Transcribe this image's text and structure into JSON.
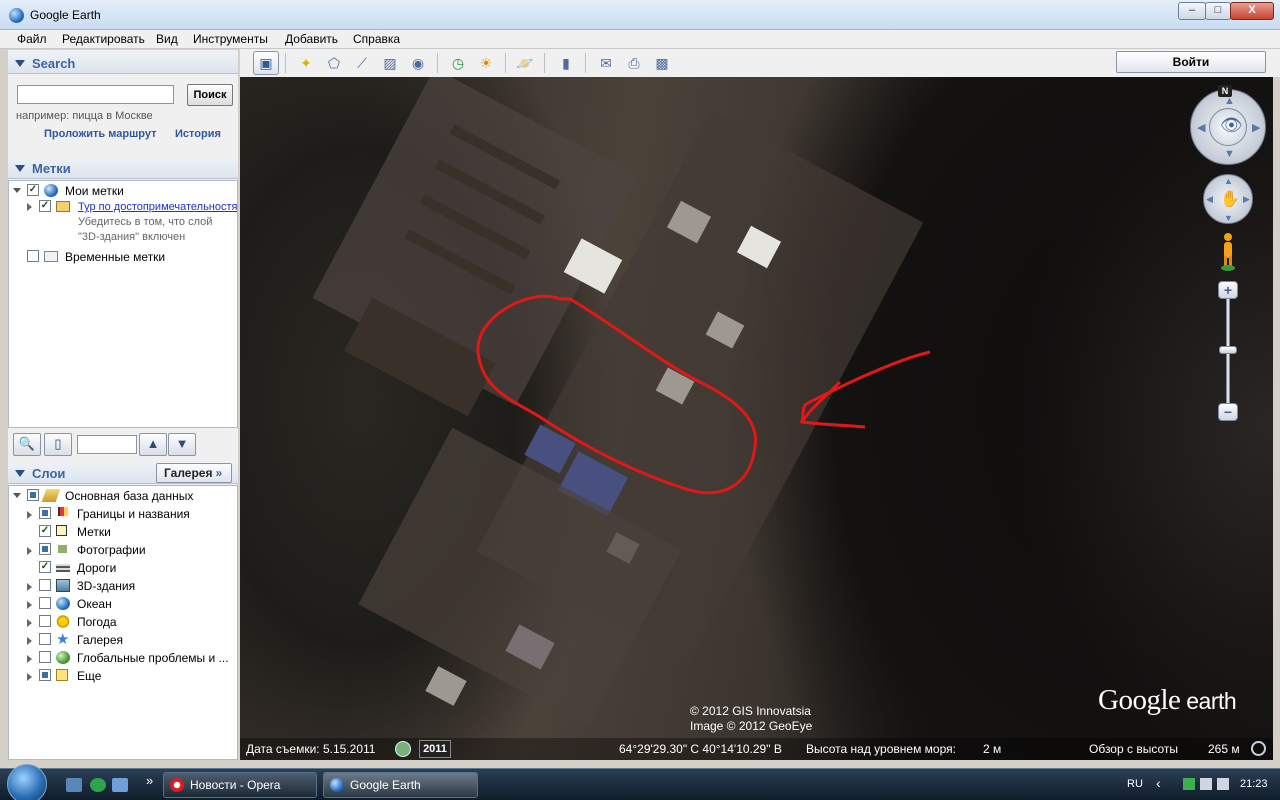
{
  "window": {
    "title": "Google Earth",
    "min_label": "–",
    "max_label": "□",
    "close_label": "X"
  },
  "menu": [
    "Файл",
    "Редактировать",
    "Вид",
    "Инструменты",
    "Добавить",
    "Справка"
  ],
  "search": {
    "header": "Search",
    "placeholder": "",
    "button": "Поиск",
    "hint": "например: пицца в Москве",
    "route_link": "Проложить маршрут",
    "history_link": "История"
  },
  "places": {
    "header": "Метки",
    "my_places": "Мои метки",
    "tour": "Тур по достопримечательностям",
    "tour_note_1": "Убедитесь в том, что слой",
    "tour_note_2": "\"3D-здания\" включен",
    "temporary": "Временные метки"
  },
  "layers": {
    "header": "Слои",
    "gallery_button": "Галерея",
    "items": [
      {
        "label": "Основная база данных",
        "state": "partial",
        "level": 0
      },
      {
        "label": "Границы и названия",
        "state": "partial",
        "level": 1
      },
      {
        "label": "Метки",
        "state": "checked",
        "level": 1
      },
      {
        "label": "Фотографии",
        "state": "partial",
        "level": 1
      },
      {
        "label": "Дороги",
        "state": "checked",
        "level": 1
      },
      {
        "label": "3D-здания",
        "state": "unchecked",
        "level": 1
      },
      {
        "label": "Океан",
        "state": "unchecked",
        "level": 1
      },
      {
        "label": "Погода",
        "state": "unchecked",
        "level": 1
      },
      {
        "label": "Галерея",
        "state": "unchecked",
        "level": 1
      },
      {
        "label": "Глобальные проблемы и ...",
        "state": "unchecked",
        "level": 1
      },
      {
        "label": "Еще",
        "state": "partial",
        "level": 1
      }
    ]
  },
  "toolbar": {
    "signin": "Войти"
  },
  "map": {
    "copyright_1": "© 2012 GIS Innovatsia",
    "copyright_2": "Image © 2012 GeoEye",
    "logo_google": "Google",
    "logo_earth": " earth",
    "north": "N",
    "status": {
      "imagery_date": "Дата съемки: 5.15.2011",
      "year": "2011",
      "coords": "64°29'29.30\" С  40°14'10.29\" В",
      "elevation_label": "Высота над уровнем моря:",
      "elevation_value": "2 м",
      "eye_label": "Обзор с высоты",
      "eye_value": "265 м"
    }
  },
  "taskbar": {
    "tasks": [
      "Новости - Opera",
      "Google Earth"
    ],
    "quicklaunch_more": "»",
    "lang": "RU",
    "tray_arrow": "‹",
    "clock": "21:23"
  },
  "colors": {
    "accent": "#3d64a4",
    "link": "#2f57a0",
    "annotation": "#e01818"
  }
}
